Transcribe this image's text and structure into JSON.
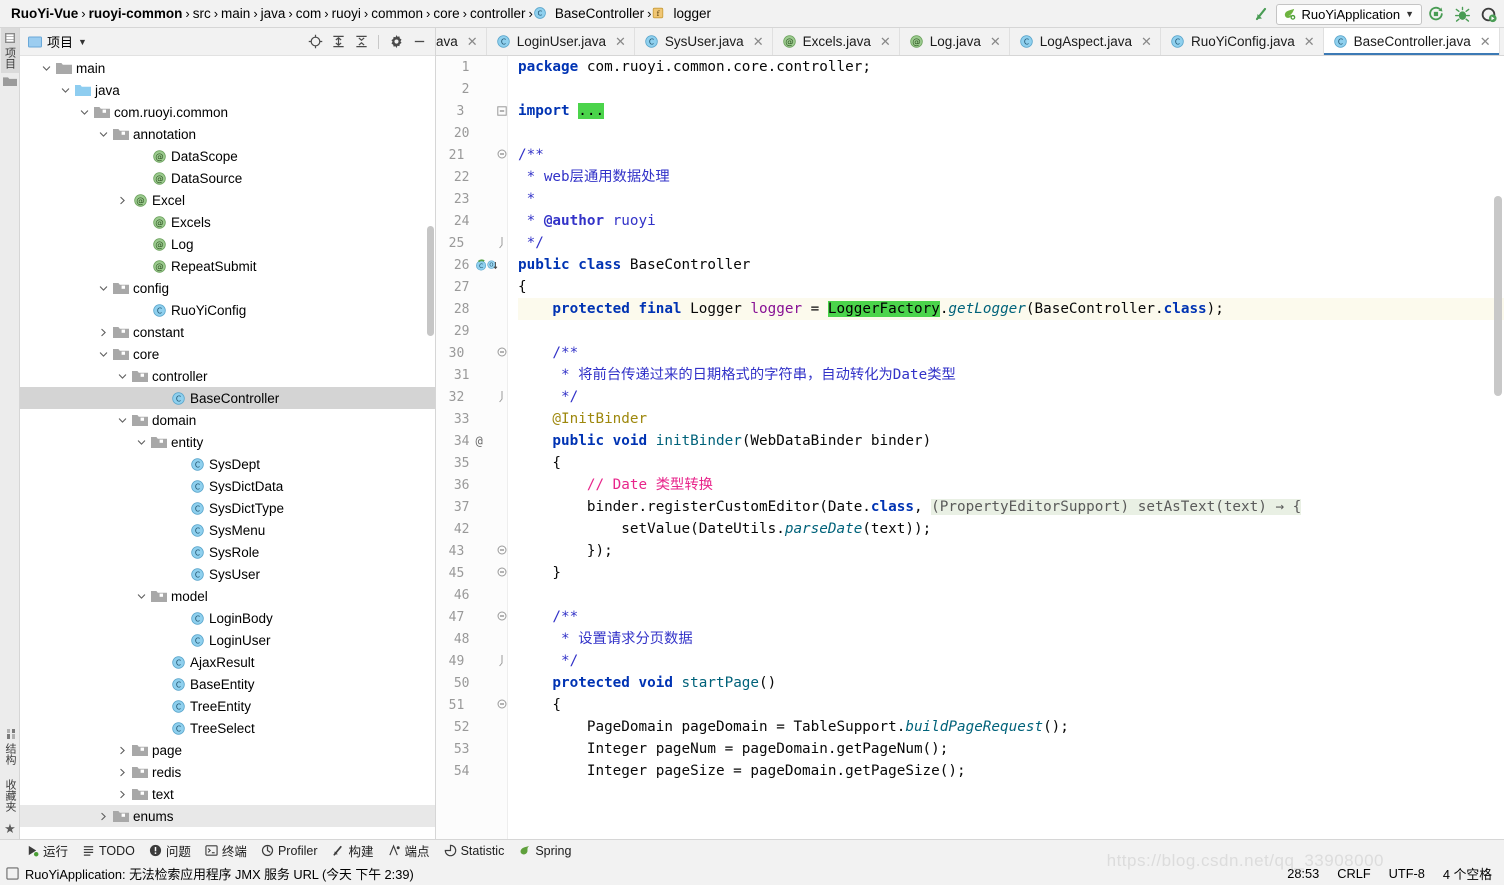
{
  "navbar": {
    "breadcrumbs": [
      {
        "label": "RuoYi-Vue",
        "bold": true,
        "icon": "none"
      },
      {
        "label": "ruoyi-common",
        "bold": true,
        "icon": "none"
      },
      {
        "label": "src",
        "bold": false,
        "icon": "none"
      },
      {
        "label": "main",
        "bold": false,
        "icon": "none"
      },
      {
        "label": "java",
        "bold": false,
        "icon": "none"
      },
      {
        "label": "com",
        "bold": false,
        "icon": "none"
      },
      {
        "label": "ruoyi",
        "bold": false,
        "icon": "none"
      },
      {
        "label": "common",
        "bold": false,
        "icon": "none"
      },
      {
        "label": "core",
        "bold": false,
        "icon": "none"
      },
      {
        "label": "controller",
        "bold": false,
        "icon": "none"
      },
      {
        "label": "BaseController",
        "bold": false,
        "icon": "class-icon"
      },
      {
        "label": "logger",
        "bold": false,
        "icon": "field-icon"
      }
    ],
    "separator": "›",
    "run_config": "RuoYiApplication",
    "icons": [
      "back-arrow-icon",
      "run-icon",
      "debug-icon",
      "run-coverage-icon"
    ]
  },
  "left_strip": {
    "top_tabs": [
      {
        "label": "项目",
        "selected": true
      }
    ],
    "bottom_tabs": [
      {
        "label": "结构"
      },
      {
        "label": "收藏夹"
      }
    ]
  },
  "project_panel": {
    "title": "项目",
    "dropdown": "▾",
    "actions": [
      "locate-icon",
      "expand-all-icon",
      "collapse-all-icon",
      "settings-gear-icon",
      "hide-icon"
    ],
    "tree": [
      {
        "label": "main",
        "indent": 2,
        "twist": "down",
        "icon": "folder-gray",
        "sel": false
      },
      {
        "label": "java",
        "indent": 3,
        "twist": "down",
        "icon": "folder-blue",
        "sel": false
      },
      {
        "label": "com.ruoyi.common",
        "indent": 4,
        "twist": "down",
        "icon": "folder-pkg",
        "sel": false
      },
      {
        "label": "annotation",
        "indent": 5,
        "twist": "down",
        "icon": "folder-pkg",
        "sel": false
      },
      {
        "label": "DataScope",
        "indent": 7,
        "twist": "none",
        "icon": "annotation",
        "sel": false
      },
      {
        "label": "DataSource",
        "indent": 7,
        "twist": "none",
        "icon": "annotation",
        "sel": false
      },
      {
        "label": "Excel",
        "indent": 6,
        "twist": "right",
        "icon": "annotation",
        "sel": false
      },
      {
        "label": "Excels",
        "indent": 7,
        "twist": "none",
        "icon": "annotation",
        "sel": false
      },
      {
        "label": "Log",
        "indent": 7,
        "twist": "none",
        "icon": "annotation",
        "sel": false
      },
      {
        "label": "RepeatSubmit",
        "indent": 7,
        "twist": "none",
        "icon": "annotation",
        "sel": false
      },
      {
        "label": "config",
        "indent": 5,
        "twist": "down",
        "icon": "folder-pkg",
        "sel": false
      },
      {
        "label": "RuoYiConfig",
        "indent": 7,
        "twist": "none",
        "icon": "class",
        "sel": false
      },
      {
        "label": "constant",
        "indent": 5,
        "twist": "right",
        "icon": "folder-pkg",
        "sel": false
      },
      {
        "label": "core",
        "indent": 5,
        "twist": "down",
        "icon": "folder-pkg",
        "sel": false
      },
      {
        "label": "controller",
        "indent": 6,
        "twist": "down",
        "icon": "folder-pkg",
        "sel": false
      },
      {
        "label": "BaseController",
        "indent": 8,
        "twist": "none",
        "icon": "class",
        "sel": true
      },
      {
        "label": "domain",
        "indent": 6,
        "twist": "down",
        "icon": "folder-pkg",
        "sel": false
      },
      {
        "label": "entity",
        "indent": 7,
        "twist": "down",
        "icon": "folder-pkg",
        "sel": false
      },
      {
        "label": "SysDept",
        "indent": 9,
        "twist": "none",
        "icon": "class",
        "sel": false
      },
      {
        "label": "SysDictData",
        "indent": 9,
        "twist": "none",
        "icon": "class",
        "sel": false
      },
      {
        "label": "SysDictType",
        "indent": 9,
        "twist": "none",
        "icon": "class",
        "sel": false
      },
      {
        "label": "SysMenu",
        "indent": 9,
        "twist": "none",
        "icon": "class",
        "sel": false
      },
      {
        "label": "SysRole",
        "indent": 9,
        "twist": "none",
        "icon": "class",
        "sel": false
      },
      {
        "label": "SysUser",
        "indent": 9,
        "twist": "none",
        "icon": "class",
        "sel": false
      },
      {
        "label": "model",
        "indent": 7,
        "twist": "down",
        "icon": "folder-pkg",
        "sel": false
      },
      {
        "label": "LoginBody",
        "indent": 9,
        "twist": "none",
        "icon": "class",
        "sel": false
      },
      {
        "label": "LoginUser",
        "indent": 9,
        "twist": "none",
        "icon": "class",
        "sel": false
      },
      {
        "label": "AjaxResult",
        "indent": 8,
        "twist": "none",
        "icon": "class",
        "sel": false
      },
      {
        "label": "BaseEntity",
        "indent": 8,
        "twist": "none",
        "icon": "class",
        "sel": false
      },
      {
        "label": "TreeEntity",
        "indent": 8,
        "twist": "none",
        "icon": "class",
        "sel": false
      },
      {
        "label": "TreeSelect",
        "indent": 8,
        "twist": "none",
        "icon": "class",
        "sel": false
      },
      {
        "label": "page",
        "indent": 6,
        "twist": "right",
        "icon": "folder-pkg",
        "sel": false
      },
      {
        "label": "redis",
        "indent": 6,
        "twist": "right",
        "icon": "folder-pkg",
        "sel": false
      },
      {
        "label": "text",
        "indent": 6,
        "twist": "right",
        "icon": "folder-pkg",
        "sel": false
      },
      {
        "label": "enums",
        "indent": 5,
        "twist": "right",
        "icon": "folder-pkg",
        "sel": false,
        "outline": true
      }
    ]
  },
  "editor_tabs": [
    {
      "label": "ava",
      "icon": "none",
      "active": false,
      "partial": true
    },
    {
      "label": "LoginUser.java",
      "icon": "class",
      "active": false
    },
    {
      "label": "SysUser.java",
      "icon": "class",
      "active": false
    },
    {
      "label": "Excels.java",
      "icon": "annotation",
      "active": false
    },
    {
      "label": "Log.java",
      "icon": "annotation",
      "active": false
    },
    {
      "label": "LogAspect.java",
      "icon": "class",
      "active": false
    },
    {
      "label": "RuoYiConfig.java",
      "icon": "class",
      "active": false
    },
    {
      "label": "BaseController.java",
      "icon": "class",
      "active": true
    }
  ],
  "editor": {
    "lines": [
      {
        "num": "1",
        "fold": "",
        "gutter": "",
        "caret": false,
        "tokens": [
          {
            "t": "package ",
            "c": "kw"
          },
          {
            "t": "com.ruoyi.common.core.controller;",
            "c": "plain"
          }
        ]
      },
      {
        "num": "2",
        "fold": "",
        "gutter": "",
        "caret": false,
        "tokens": []
      },
      {
        "num": "3",
        "fold": "plus",
        "gutter": "",
        "caret": false,
        "tokens": [
          {
            "t": "import ",
            "c": "kw"
          },
          {
            "t": "...",
            "c": "sel-green"
          }
        ]
      },
      {
        "num": "20",
        "fold": "",
        "gutter": "",
        "caret": false,
        "tokens": []
      },
      {
        "num": "21",
        "fold": "minus",
        "gutter": "",
        "caret": false,
        "tokens": [
          {
            "t": "/**",
            "c": "jdoc"
          }
        ]
      },
      {
        "num": "22",
        "fold": "",
        "gutter": "",
        "caret": false,
        "tokens": [
          {
            "t": " * web层通用数据处理",
            "c": "jdoc"
          }
        ]
      },
      {
        "num": "23",
        "fold": "",
        "gutter": "",
        "caret": false,
        "tokens": [
          {
            "t": " *",
            "c": "jdoc"
          }
        ]
      },
      {
        "num": "24",
        "fold": "",
        "gutter": "",
        "caret": false,
        "tokens": [
          {
            "t": " * ",
            "c": "jdoc"
          },
          {
            "t": "@author",
            "c": "jdoctag"
          },
          {
            "t": " ruoyi",
            "c": "jdoc"
          }
        ]
      },
      {
        "num": "25",
        "fold": "end",
        "gutter": "",
        "caret": false,
        "tokens": [
          {
            "t": " */",
            "c": "jdoc"
          }
        ]
      },
      {
        "num": "26",
        "fold": "",
        "gutter": "bean",
        "caret": false,
        "tokens": [
          {
            "t": "public class ",
            "c": "kw"
          },
          {
            "t": "BaseController",
            "c": "plain"
          }
        ]
      },
      {
        "num": "27",
        "fold": "",
        "gutter": "",
        "caret": false,
        "tokens": [
          {
            "t": "{",
            "c": "plain"
          }
        ]
      },
      {
        "num": "28",
        "fold": "",
        "gutter": "",
        "caret": true,
        "tokens": [
          {
            "t": "    protected final ",
            "c": "kw"
          },
          {
            "t": "Logger ",
            "c": "plain"
          },
          {
            "t": "logger",
            "c": "fld"
          },
          {
            "t": " = ",
            "c": "plain"
          },
          {
            "t": "LoggerFactory",
            "c": "sel-green"
          },
          {
            "t": ".",
            "c": "plain"
          },
          {
            "t": "getLogger",
            "c": "stat"
          },
          {
            "t": "(BaseController.",
            "c": "plain"
          },
          {
            "t": "class",
            "c": "kw"
          },
          {
            "t": ");",
            "c": "plain"
          }
        ]
      },
      {
        "num": "29",
        "fold": "",
        "gutter": "",
        "caret": false,
        "tokens": []
      },
      {
        "num": "30",
        "fold": "minus",
        "gutter": "",
        "caret": false,
        "tokens": [
          {
            "t": "    /**",
            "c": "jdoc"
          }
        ]
      },
      {
        "num": "31",
        "fold": "",
        "gutter": "",
        "caret": false,
        "tokens": [
          {
            "t": "     * 将前台传递过来的日期格式的字符串，自动转化为Date类型",
            "c": "jdoc"
          }
        ]
      },
      {
        "num": "32",
        "fold": "end",
        "gutter": "",
        "caret": false,
        "tokens": [
          {
            "t": "     */",
            "c": "jdoc"
          }
        ]
      },
      {
        "num": "33",
        "fold": "",
        "gutter": "",
        "caret": false,
        "tokens": [
          {
            "t": "    @InitBinder",
            "c": "anno"
          }
        ]
      },
      {
        "num": "34",
        "fold": "",
        "gutter": "at",
        "caret": false,
        "tokens": [
          {
            "t": "    public void ",
            "c": "kw"
          },
          {
            "t": "initBinder",
            "c": "mth"
          },
          {
            "t": "(WebDataBinder binder)",
            "c": "plain"
          }
        ]
      },
      {
        "num": "35",
        "fold": "",
        "gutter": "",
        "caret": false,
        "tokens": [
          {
            "t": "    {",
            "c": "plain"
          }
        ]
      },
      {
        "num": "36",
        "fold": "",
        "gutter": "",
        "caret": false,
        "tokens": [
          {
            "t": "        // Date 类型转换",
            "c": "cmt-pink"
          }
        ]
      },
      {
        "num": "37",
        "fold": "",
        "gutter": "",
        "caret": false,
        "tokens": [
          {
            "t": "        binder.registerCustomEditor(Date.",
            "c": "plain"
          },
          {
            "t": "class",
            "c": "kw"
          },
          {
            "t": ", ",
            "c": "plain"
          },
          {
            "t": "(PropertyEditorSupport) setAsText(text) → {",
            "c": "inlay"
          }
        ]
      },
      {
        "num": "42",
        "fold": "",
        "gutter": "",
        "caret": false,
        "tokens": [
          {
            "t": "            setValue(DateUtils.",
            "c": "plain"
          },
          {
            "t": "parseDate",
            "c": "stat"
          },
          {
            "t": "(text));",
            "c": "plain"
          }
        ]
      },
      {
        "num": "43",
        "fold": "minus",
        "gutter": "",
        "caret": false,
        "tokens": [
          {
            "t": "        });",
            "c": "plain"
          }
        ]
      },
      {
        "num": "45",
        "fold": "minus",
        "gutter": "",
        "caret": false,
        "tokens": [
          {
            "t": "    }",
            "c": "plain"
          }
        ]
      },
      {
        "num": "46",
        "fold": "",
        "gutter": "",
        "caret": false,
        "tokens": []
      },
      {
        "num": "47",
        "fold": "minus",
        "gutter": "",
        "caret": false,
        "tokens": [
          {
            "t": "    /**",
            "c": "jdoc"
          }
        ]
      },
      {
        "num": "48",
        "fold": "",
        "gutter": "",
        "caret": false,
        "tokens": [
          {
            "t": "     * 设置请求分页数据",
            "c": "jdoc"
          }
        ]
      },
      {
        "num": "49",
        "fold": "end",
        "gutter": "",
        "caret": false,
        "tokens": [
          {
            "t": "     */",
            "c": "jdoc"
          }
        ]
      },
      {
        "num": "50",
        "fold": "",
        "gutter": "",
        "caret": false,
        "tokens": [
          {
            "t": "    protected void ",
            "c": "kw"
          },
          {
            "t": "startPage",
            "c": "mth"
          },
          {
            "t": "()",
            "c": "plain"
          }
        ]
      },
      {
        "num": "51",
        "fold": "minus",
        "gutter": "",
        "caret": false,
        "tokens": [
          {
            "t": "    {",
            "c": "plain"
          }
        ]
      },
      {
        "num": "52",
        "fold": "",
        "gutter": "",
        "caret": false,
        "tokens": [
          {
            "t": "        PageDomain pageDomain = TableSupport.",
            "c": "plain"
          },
          {
            "t": "buildPageRequest",
            "c": "stat"
          },
          {
            "t": "();",
            "c": "plain"
          }
        ]
      },
      {
        "num": "53",
        "fold": "",
        "gutter": "",
        "caret": false,
        "tokens": [
          {
            "t": "        Integer pageNum = pageDomain.getPageNum();",
            "c": "plain"
          }
        ]
      },
      {
        "num": "54",
        "fold": "",
        "gutter": "",
        "caret": false,
        "tokens": [
          {
            "t": "        Integer pageSize = pageDomain.getPageSize();",
            "c": "plain"
          }
        ]
      }
    ]
  },
  "toolwindow_bar": [
    {
      "label": "运行",
      "icon": "run-icon"
    },
    {
      "label": "TODO",
      "icon": "todo-icon"
    },
    {
      "label": "问题",
      "icon": "problems-icon"
    },
    {
      "label": "终端",
      "icon": "terminal-icon"
    },
    {
      "label": "Profiler",
      "icon": "profiler-icon"
    },
    {
      "label": "构建",
      "icon": "build-icon"
    },
    {
      "label": "端点",
      "icon": "endpoints-icon"
    },
    {
      "label": "Statistic",
      "icon": "statistic-icon"
    },
    {
      "label": "Spring",
      "icon": "spring-icon"
    }
  ],
  "statusbar": {
    "message": "RuoYiApplication: 无法检索应用程序 JMX 服务 URL (今天 下午 2:39)",
    "caret_position": "28:53",
    "line_separator": "CRLF",
    "encoding": "UTF-8",
    "indent": "4 个空格",
    "watermark": "https://blog.csdn.net/qq_33908000"
  },
  "colors": {
    "accent_blue": "#3c7ab5",
    "selection_green": "#4bd44b",
    "caret_line": "#fcfaed",
    "keyword": "#0033b3",
    "javadoc": "#3232c8",
    "annotation": "#9e880d",
    "field": "#871094",
    "method": "#00627a"
  }
}
